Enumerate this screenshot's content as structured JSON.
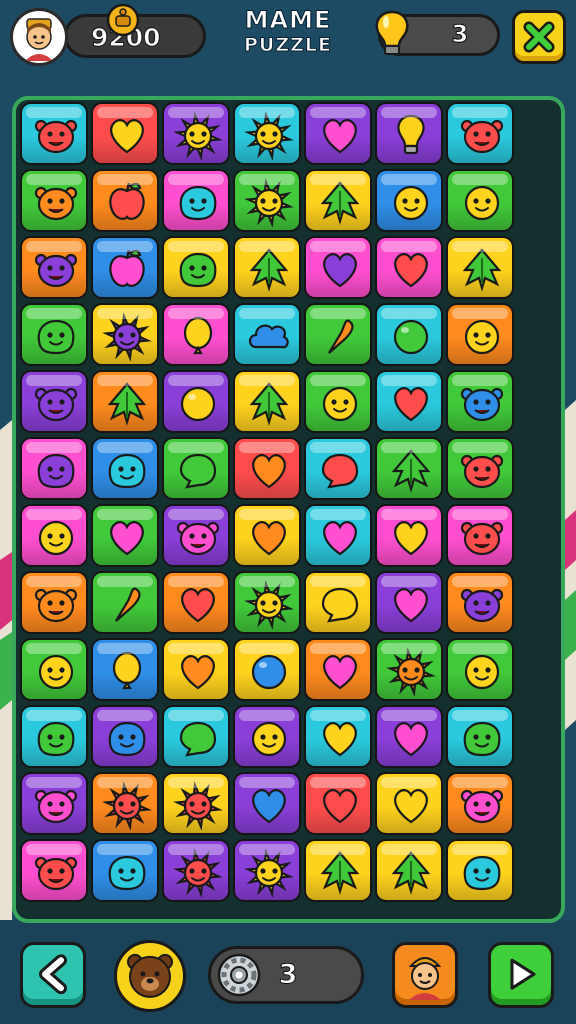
{
  "header": {
    "score": "9200",
    "title_line1": "MAME",
    "title_line2": "PUZZLE",
    "hints": "3"
  },
  "footer": {
    "moves": "3"
  },
  "colors": {
    "red": "#ff4d4d",
    "orange": "#ff8a1e",
    "yellow": "#ffd21e",
    "green": "#41c93a",
    "cyan": "#2bc9dd",
    "blue": "#2f8fe8",
    "purple": "#8a3fd8",
    "pink": "#ff4fd0"
  },
  "board": {
    "rows": [
      [
        {
          "bg": "cyan",
          "icon": "monster",
          "ic": "red"
        },
        {
          "bg": "red",
          "icon": "heart",
          "ic": "yellow"
        },
        {
          "bg": "purple",
          "icon": "sun",
          "ic": "yellow"
        },
        {
          "bg": "cyan",
          "icon": "sun",
          "ic": "yellow"
        },
        {
          "bg": "purple",
          "icon": "heart",
          "ic": "pink"
        },
        {
          "bg": "purple",
          "icon": "bulb",
          "ic": "yellow"
        },
        {
          "bg": "cyan",
          "icon": "monster",
          "ic": "red"
        }
      ],
      [
        {
          "bg": "green",
          "icon": "monster",
          "ic": "orange"
        },
        {
          "bg": "orange",
          "icon": "apple",
          "ic": "red"
        },
        {
          "bg": "pink",
          "icon": "blob",
          "ic": "cyan"
        },
        {
          "bg": "green",
          "icon": "sun",
          "ic": "yellow"
        },
        {
          "bg": "yellow",
          "icon": "leaf",
          "ic": "green"
        },
        {
          "bg": "blue",
          "icon": "face",
          "ic": "yellow"
        },
        {
          "bg": "green",
          "icon": "face",
          "ic": "yellow"
        }
      ],
      [
        {
          "bg": "orange",
          "icon": "monster",
          "ic": "purple"
        },
        {
          "bg": "blue",
          "icon": "apple",
          "ic": "pink"
        },
        {
          "bg": "yellow",
          "icon": "blob",
          "ic": "green"
        },
        {
          "bg": "yellow",
          "icon": "leaf",
          "ic": "green"
        },
        {
          "bg": "pink",
          "icon": "heart",
          "ic": "purple"
        },
        {
          "bg": "pink",
          "icon": "heart",
          "ic": "red"
        },
        {
          "bg": "yellow",
          "icon": "leaf",
          "ic": "green"
        }
      ],
      [
        {
          "bg": "green",
          "icon": "blob",
          "ic": "green"
        },
        {
          "bg": "yellow",
          "icon": "sun",
          "ic": "purple"
        },
        {
          "bg": "pink",
          "icon": "balloon",
          "ic": "yellow"
        },
        {
          "bg": "cyan",
          "icon": "cloud",
          "ic": "blue"
        },
        {
          "bg": "green",
          "icon": "carrot",
          "ic": "orange"
        },
        {
          "bg": "cyan",
          "icon": "circle",
          "ic": "green"
        },
        {
          "bg": "orange",
          "icon": "face",
          "ic": "yellow"
        }
      ],
      [
        {
          "bg": "purple",
          "icon": "monster",
          "ic": "purple"
        },
        {
          "bg": "orange",
          "icon": "leaf",
          "ic": "green"
        },
        {
          "bg": "purple",
          "icon": "circle",
          "ic": "yellow"
        },
        {
          "bg": "yellow",
          "icon": "leaf",
          "ic": "green"
        },
        {
          "bg": "green",
          "icon": "face",
          "ic": "yellow"
        },
        {
          "bg": "cyan",
          "icon": "heart",
          "ic": "red"
        },
        {
          "bg": "green",
          "icon": "monster",
          "ic": "blue"
        }
      ],
      [
        {
          "bg": "pink",
          "icon": "blob",
          "ic": "purple"
        },
        {
          "bg": "blue",
          "icon": "blob",
          "ic": "cyan"
        },
        {
          "bg": "green",
          "icon": "bubble",
          "ic": "green"
        },
        {
          "bg": "red",
          "icon": "heart",
          "ic": "orange"
        },
        {
          "bg": "cyan",
          "icon": "bubble",
          "ic": "red"
        },
        {
          "bg": "green",
          "icon": "leaf",
          "ic": "green"
        },
        {
          "bg": "green",
          "icon": "monster",
          "ic": "red"
        }
      ],
      [
        {
          "bg": "pink",
          "icon": "face",
          "ic": "yellow"
        },
        {
          "bg": "green",
          "icon": "heart",
          "ic": "pink"
        },
        {
          "bg": "purple",
          "icon": "monster",
          "ic": "pink"
        },
        {
          "bg": "yellow",
          "icon": "heart",
          "ic": "orange"
        },
        {
          "bg": "cyan",
          "icon": "heart",
          "ic": "pink"
        },
        {
          "bg": "pink",
          "icon": "heart",
          "ic": "yellow"
        },
        {
          "bg": "pink",
          "icon": "monster",
          "ic": "red"
        }
      ],
      [
        {
          "bg": "orange",
          "icon": "monster",
          "ic": "orange"
        },
        {
          "bg": "green",
          "icon": "carrot",
          "ic": "orange"
        },
        {
          "bg": "orange",
          "icon": "heart",
          "ic": "red"
        },
        {
          "bg": "green",
          "icon": "sun",
          "ic": "yellow"
        },
        {
          "bg": "yellow",
          "icon": "bubble",
          "ic": "yellow"
        },
        {
          "bg": "purple",
          "icon": "heart",
          "ic": "pink"
        },
        {
          "bg": "orange",
          "icon": "monster",
          "ic": "purple"
        }
      ],
      [
        {
          "bg": "green",
          "icon": "face",
          "ic": "yellow"
        },
        {
          "bg": "blue",
          "icon": "balloon",
          "ic": "yellow"
        },
        {
          "bg": "yellow",
          "icon": "heart",
          "ic": "orange"
        },
        {
          "bg": "yellow",
          "icon": "circle",
          "ic": "blue"
        },
        {
          "bg": "orange",
          "icon": "heart",
          "ic": "pink"
        },
        {
          "bg": "green",
          "icon": "sun",
          "ic": "orange"
        },
        {
          "bg": "green",
          "icon": "face",
          "ic": "yellow"
        }
      ],
      [
        {
          "bg": "cyan",
          "icon": "blob",
          "ic": "green"
        },
        {
          "bg": "purple",
          "icon": "blob",
          "ic": "blue"
        },
        {
          "bg": "cyan",
          "icon": "bubble",
          "ic": "green"
        },
        {
          "bg": "purple",
          "icon": "face",
          "ic": "yellow"
        },
        {
          "bg": "cyan",
          "icon": "heart",
          "ic": "yellow"
        },
        {
          "bg": "purple",
          "icon": "heart",
          "ic": "pink"
        },
        {
          "bg": "cyan",
          "icon": "blob",
          "ic": "green"
        }
      ],
      [
        {
          "bg": "purple",
          "icon": "monster",
          "ic": "pink"
        },
        {
          "bg": "orange",
          "icon": "sun",
          "ic": "red"
        },
        {
          "bg": "yellow",
          "icon": "sun",
          "ic": "red"
        },
        {
          "bg": "purple",
          "icon": "heart",
          "ic": "blue"
        },
        {
          "bg": "red",
          "icon": "heart",
          "ic": "red"
        },
        {
          "bg": "yellow",
          "icon": "heart",
          "ic": "yellow"
        },
        {
          "bg": "orange",
          "icon": "monster",
          "ic": "pink"
        }
      ],
      [
        {
          "bg": "pink",
          "icon": "monster",
          "ic": "red"
        },
        {
          "bg": "blue",
          "icon": "blob",
          "ic": "cyan"
        },
        {
          "bg": "purple",
          "icon": "sun",
          "ic": "red"
        },
        {
          "bg": "purple",
          "icon": "sun",
          "ic": "yellow"
        },
        {
          "bg": "yellow",
          "icon": "leaf",
          "ic": "green"
        },
        {
          "bg": "yellow",
          "icon": "leaf",
          "ic": "green"
        },
        {
          "bg": "yellow",
          "icon": "blob",
          "ic": "cyan"
        }
      ]
    ]
  },
  "icons": {
    "avatar": "player-avatar-icon",
    "score_badge": "bell-badge-icon",
    "hint": "lightbulb-icon",
    "close": "close-x-icon",
    "back": "back-arrow-icon",
    "bear": "bear-icon",
    "gear": "gear-icon",
    "character": "character-icon",
    "play": "play-icon"
  }
}
